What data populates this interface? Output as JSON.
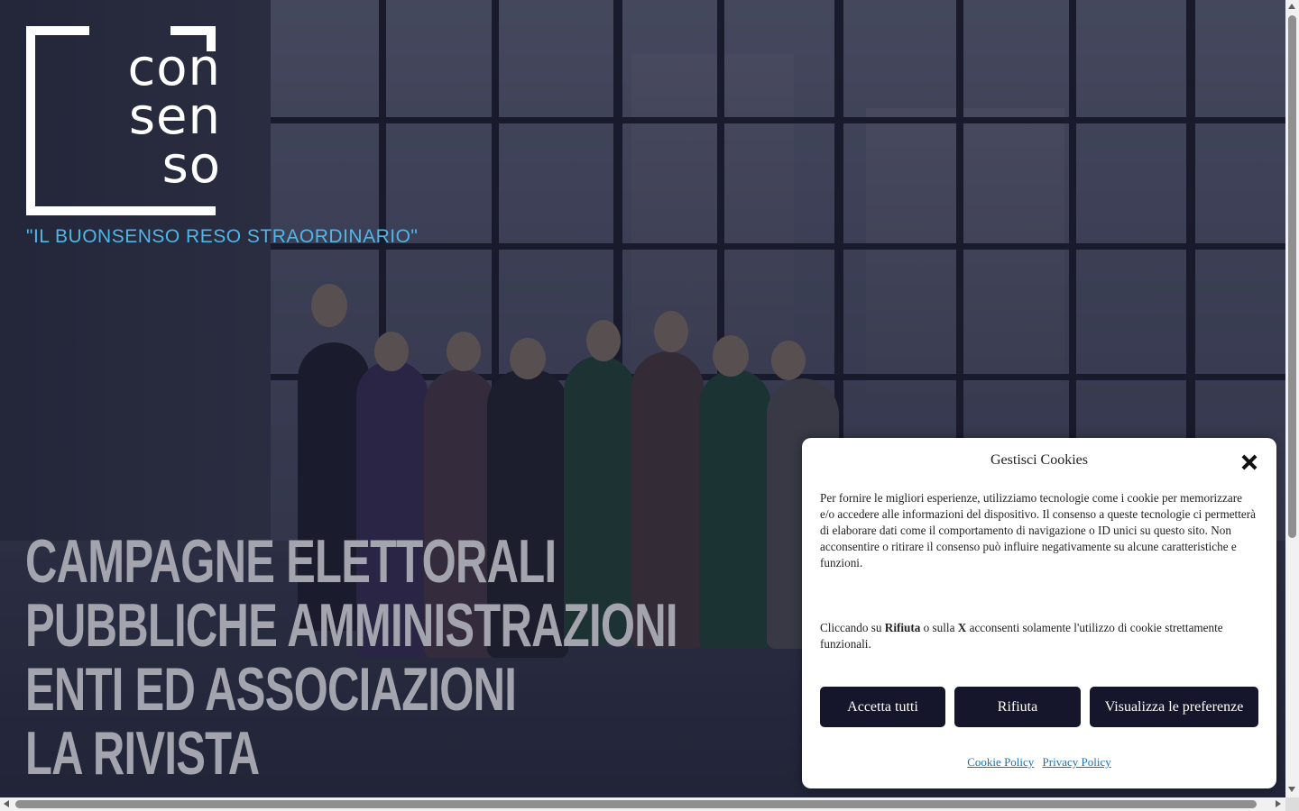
{
  "logo": {
    "line1": "con",
    "line2": "sen",
    "line3": "so",
    "tagline": "\"IL BUONSENSO RESO STRAORDINARIO\""
  },
  "hero_menu": [
    {
      "label": "CAMPAGNE ELETTORALI"
    },
    {
      "label": "PUBBLICHE AMMINISTRAZIONI"
    },
    {
      "label": "ENTI ED ASSOCIAZIONI"
    },
    {
      "label": "LA RIVISTA"
    }
  ],
  "cookie_banner": {
    "title": "Gestisci Cookies",
    "body": "Per fornire le migliori esperienze, utilizziamo tecnologie come i cookie per memorizzare e/o accedere alle informazioni del dispositivo. Il consenso a queste tecnologie ci permetterà di elaborare dati come il comportamento di navigazione o ID unici su questo sito. Non acconsentire o ritirare il consenso può influire negativamente su alcune caratteristiche e funzioni.",
    "note_prefix": "Cliccando su ",
    "note_bold1": "Rifiuta",
    "note_mid": " o sulla ",
    "note_bold2": "X",
    "note_suffix": " acconsenti solamente l'utilizzo di cookie strettamente funzionali.",
    "accept_label": "Accetta tutti",
    "deny_label": "Rifiuta",
    "prefs_label": "Visualizza le preferenze",
    "cookie_policy_label": "Cookie Policy",
    "privacy_policy_label": "Privacy Policy"
  },
  "colors": {
    "accent": "#4fb7e8",
    "button_bg": "#15162b",
    "link": "#1f6fb2"
  }
}
